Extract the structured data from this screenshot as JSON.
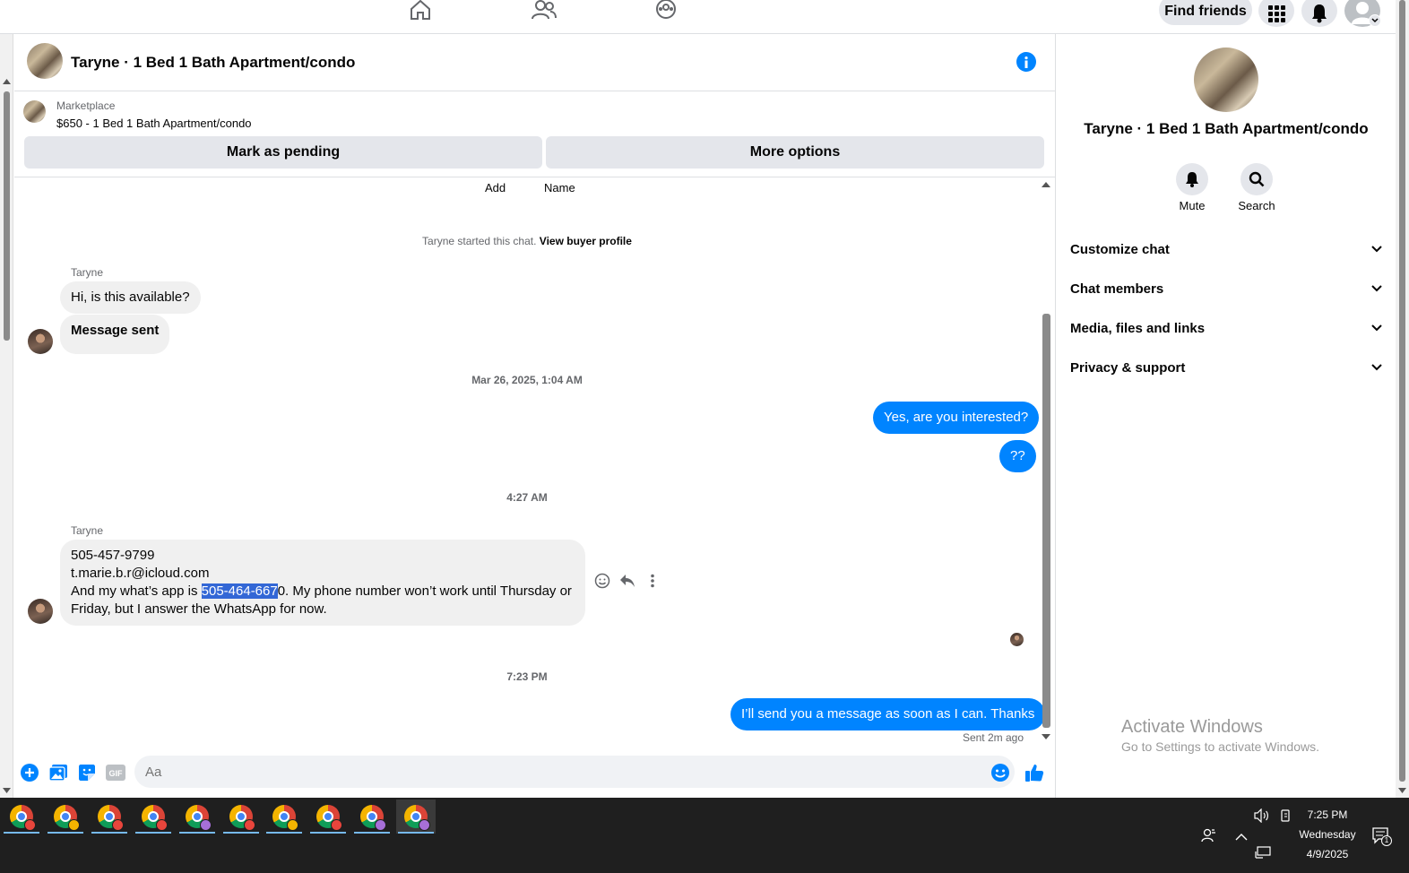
{
  "topnav": {
    "find_friends_label": "Find friends"
  },
  "chat_header": {
    "title": "Taryne · 1 Bed 1 Bath Apartment/condo"
  },
  "marketplace": {
    "label": "Marketplace",
    "listing": "$650 - 1 Bed 1 Bath Apartment/condo",
    "mark_pending_label": "Mark as pending",
    "more_options_label": "More options"
  },
  "chat": {
    "top_labels": [
      "Add",
      "Name"
    ],
    "started_text": "Taryne started this chat.",
    "view_profile_link": "View buyer profile",
    "sender_name": "Taryne",
    "msg1": "Hi, is this available?",
    "msg2": "Message sent",
    "ts1": "Mar 26, 2025, 1:04 AM",
    "out1": "Yes, are you interested?",
    "out2": "??",
    "ts2": "4:27 AM",
    "long_line1": "505-457-9799",
    "long_line2": "t.marie.b.r@icloud.com",
    "long_line3_pre": "And my what’s app is ",
    "long_line3_highlight": "505-464-667",
    "long_line3_post": "0. My phone number won’t work until Thursday or",
    "long_line4": "Friday, but I answer the WhatsApp for now.",
    "ts3": "7:23 PM",
    "out3": "I’ll send you a message as soon as I can. Thanks",
    "sent_status": "Sent 2m ago"
  },
  "composer": {
    "placeholder": "Aa"
  },
  "right_panel": {
    "title": "Taryne · 1 Bed 1 Bath Apartment/condo",
    "mute_label": "Mute",
    "search_label": "Search",
    "sections": [
      "Customize chat",
      "Chat members",
      "Media, files and links",
      "Privacy & support"
    ]
  },
  "watermark": {
    "line1": "Activate Windows",
    "line2": "Go to Settings to activate Windows."
  },
  "taskbar": {
    "time": "7:25 PM",
    "day": "Wednesday",
    "date": "4/9/2025",
    "notification_count": "1",
    "profile_colors": [
      "#e8453c",
      "#f4b400",
      "#e8453c",
      "#e8453c",
      "#a66fd8",
      "#e8453c",
      "#f4b400",
      "#e8453c",
      "#a66fd8",
      "#a66fd8"
    ]
  },
  "colors": {
    "accent": "#0084ff",
    "highlight": "#3367d6"
  }
}
